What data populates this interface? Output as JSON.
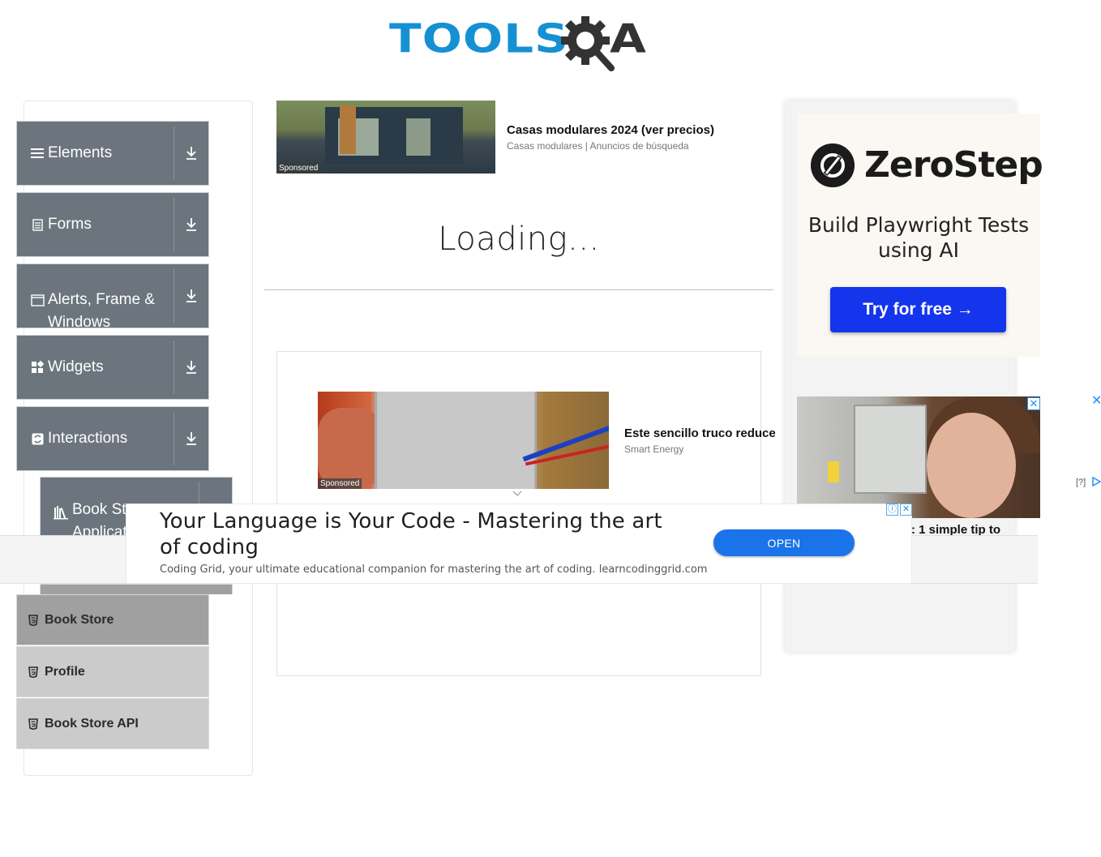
{
  "logo": {
    "tools": "TOOLS",
    "a": "A"
  },
  "sidebar": {
    "groups": [
      {
        "label": "Elements",
        "icon": "menu-lines-icon"
      },
      {
        "label": "Forms",
        "icon": "document-icon"
      },
      {
        "label": "Alerts, Frame & Windows",
        "icon": "window-icon"
      },
      {
        "label": "Widgets",
        "icon": "widgets-icon"
      },
      {
        "label": "Interactions",
        "icon": "interactions-icon"
      },
      {
        "label": "Book Store Application",
        "icon": "books-icon"
      }
    ],
    "book_items": [
      {
        "label": "Book Store",
        "active": true
      },
      {
        "label": "Profile",
        "active": false
      },
      {
        "label": "Book Store API",
        "active": false
      }
    ]
  },
  "ad_top": {
    "title": "Casas modulares 2024 (ver precios)",
    "source": "Casas modulares | Anuncios de búsqueda",
    "sponsored": "Sponsored"
  },
  "main": {
    "loading": "Loading..."
  },
  "ad_mid": {
    "title": "Este sencillo truco reduce",
    "source": "Smart Energy",
    "sponsored": "Sponsored"
  },
  "zerostep": {
    "brand": "ZeroStep",
    "tagline": "Build Playwright Tests using AI",
    "button": "Try for free →"
  },
  "ad_right": {
    "close": "✕",
    "text": ": 1 simple tip to",
    "outer_close": "✕",
    "help": "[?]"
  },
  "adchoices": {
    "info": "ⓘ",
    "close": "✕"
  },
  "banner": {
    "title": "Your Language is Your Code - Mastering the art of coding",
    "description": "Coding Grid, your ultimate educational companion for mastering the art of coding. learncodinggrid.com",
    "button": "OPEN"
  },
  "colors": {
    "sidebar_group_bg": "#6c757d",
    "accent_blue": "#1591d3",
    "zerostep_button": "#1435ec",
    "banner_button": "#1a73e8"
  }
}
